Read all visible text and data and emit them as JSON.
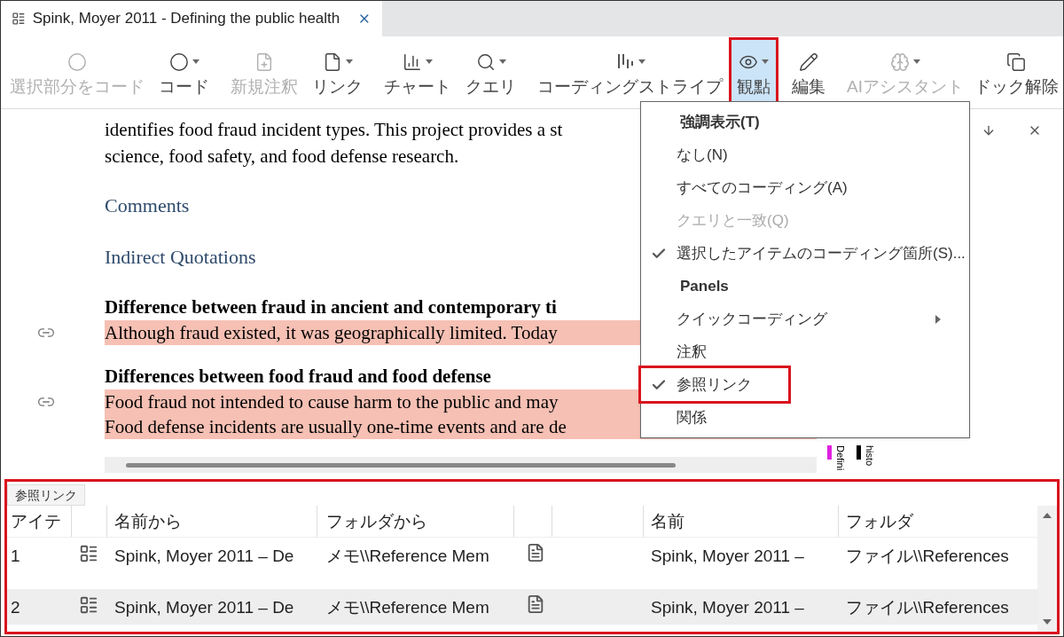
{
  "tab": {
    "title": "Spink, Moyer 2011 - Defining the public health",
    "selected": true
  },
  "toolbar": {
    "groups": [
      [
        {
          "label": "選択部分をコード",
          "kind": "circle",
          "disabled": true,
          "dropdown": false,
          "selected": false,
          "highlighted": false
        },
        {
          "label": "コード",
          "kind": "circle",
          "disabled": false,
          "dropdown": true,
          "selected": false,
          "highlighted": false
        }
      ],
      [
        {
          "label": "新規注釈",
          "kind": "newdoc",
          "disabled": true,
          "dropdown": false,
          "selected": false,
          "highlighted": false
        },
        {
          "label": "リンク",
          "kind": "doc",
          "disabled": false,
          "dropdown": true,
          "selected": false,
          "highlighted": false
        }
      ],
      [
        {
          "label": "チャート",
          "kind": "chart",
          "disabled": false,
          "dropdown": true,
          "selected": false,
          "highlighted": false
        },
        {
          "label": "クエリ",
          "kind": "query",
          "disabled": false,
          "dropdown": true,
          "selected": false,
          "highlighted": false
        }
      ],
      [
        {
          "label": "コーディングストライプ",
          "kind": "stripes",
          "disabled": false,
          "dropdown": true,
          "selected": false,
          "highlighted": false
        },
        {
          "label": "観點",
          "kind": "eye",
          "disabled": false,
          "dropdown": true,
          "selected": true,
          "highlighted": true
        }
      ],
      [
        {
          "label": "編集",
          "kind": "pencil",
          "disabled": false,
          "dropdown": false,
          "selected": false,
          "highlighted": false
        }
      ],
      [
        {
          "label": "AIアシスタント",
          "kind": "brain",
          "disabled": true,
          "dropdown": true,
          "selected": false,
          "highlighted": false
        }
      ]
    ],
    "end": {
      "label": "ドック解除",
      "kind": "undock",
      "disabled": false,
      "dropdown": false,
      "selected": false,
      "highlighted": false
    }
  },
  "document": {
    "blocks": [
      {
        "kind": "text",
        "lines": [
          "identifies food fraud incident types. This project provides a st",
          "science, food safety, and food defense research."
        ]
      },
      {
        "kind": "heading",
        "lines": [
          "Comments"
        ]
      },
      {
        "kind": "heading",
        "lines": [
          "Indirect Quotations"
        ]
      },
      {
        "kind": "quote",
        "title": "Difference between fraud in ancient and contemporary ti",
        "lines": [
          "Although fraud existed, it was geographically limited. Today"
        ]
      },
      {
        "kind": "quote",
        "title": "Differences between food fraud and food defense",
        "lines": [
          "Food fraud not intended to cause harm to the public and may",
          "Food defense incidents are usually one-time events and are de"
        ]
      }
    ]
  },
  "stripes": [
    {
      "label": "Defini",
      "color": "#e020e0"
    },
    {
      "label": "histo",
      "color": "#000000"
    }
  ],
  "menu": {
    "items": [
      {
        "kind": "header",
        "label": "強調表示(T)"
      },
      {
        "kind": "item",
        "label": "なし(N)",
        "checked": false,
        "disabled": false,
        "highlighted": false
      },
      {
        "kind": "item",
        "label": "すべてのコーディング(A)",
        "checked": false,
        "disabled": false,
        "highlighted": false
      },
      {
        "kind": "item",
        "label": "クエリと一致(Q)",
        "checked": false,
        "disabled": true,
        "highlighted": false
      },
      {
        "kind": "item",
        "label": "選択したアイテムのコーディング箇所(S)...",
        "checked": true,
        "disabled": false,
        "highlighted": false
      },
      {
        "kind": "header",
        "label": "Panels"
      },
      {
        "kind": "submenu",
        "label": "クイックコーディング",
        "checked": false,
        "disabled": false,
        "highlighted": false
      },
      {
        "kind": "item",
        "label": "注釈",
        "checked": false,
        "disabled": false,
        "highlighted": false
      },
      {
        "kind": "item",
        "label": "参照リンク",
        "checked": true,
        "disabled": false,
        "highlighted": true
      },
      {
        "kind": "item",
        "label": "関係",
        "checked": false,
        "disabled": false,
        "highlighted": false
      }
    ]
  },
  "panel": {
    "tab": "参照リンク",
    "highlighted": true,
    "columns": [
      "アイテ",
      "名前から",
      "フォルダから",
      "名前",
      "フォルダ"
    ],
    "rows": [
      {
        "number": "1",
        "from_name": "Spink,  Moyer  2011 – De",
        "from_folder": "メモ\\\\Reference Mem",
        "to_name": "Spink,  Moyer  2011 –",
        "to_folder": "ファイル\\\\References",
        "selected": false
      },
      {
        "number": "2",
        "from_name": "Spink,  Moyer  2011 – De",
        "from_folder": "メモ\\\\Reference Mem",
        "to_name": "Spink,  Moyer  2011 –",
        "to_folder": "ファイル\\\\References",
        "selected": true
      }
    ]
  }
}
